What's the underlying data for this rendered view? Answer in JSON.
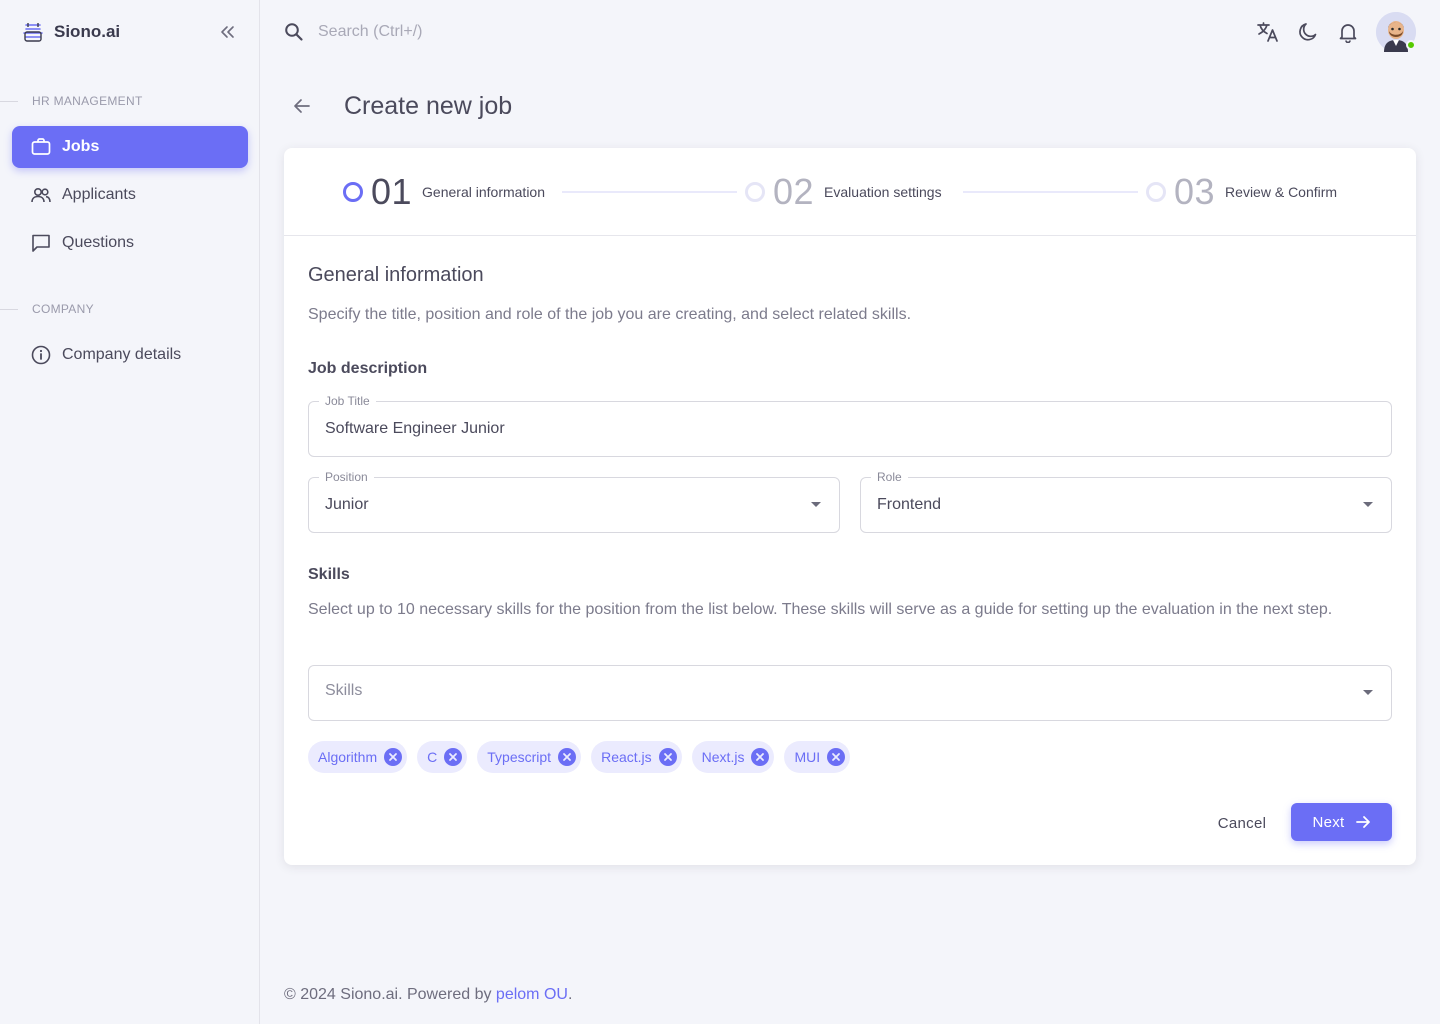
{
  "brand": {
    "name": "Siono.ai"
  },
  "sidebar": {
    "sections": [
      {
        "heading": "HR MANAGEMENT"
      },
      {
        "heading": "COMPANY"
      }
    ],
    "items": [
      {
        "label": "Jobs",
        "icon": "briefcase-icon",
        "active": true
      },
      {
        "label": "Applicants",
        "icon": "users-icon"
      },
      {
        "label": "Questions",
        "icon": "message-icon"
      },
      {
        "label": "Company details",
        "icon": "info-icon"
      }
    ]
  },
  "topbar": {
    "search_placeholder": "Search (Ctrl+/)",
    "icons": [
      "translate-icon",
      "moon-icon",
      "bell-icon"
    ],
    "status_color": "#56ca00"
  },
  "page": {
    "title": "Create new job"
  },
  "stepper": {
    "steps": [
      {
        "number": "01",
        "label": "General information",
        "active": true
      },
      {
        "number": "02",
        "label": "Evaluation settings"
      },
      {
        "number": "03",
        "label": "Review & Confirm"
      }
    ]
  },
  "general": {
    "title": "General information",
    "description": "Specify the title, position and role of the job you are creating, and select related skills.",
    "job_description_heading": "Job description"
  },
  "form": {
    "job_title": {
      "label": "Job Title",
      "value": "Software Engineer Junior"
    },
    "position": {
      "label": "Position",
      "value": "Junior"
    },
    "role": {
      "label": "Role",
      "value": "Frontend"
    }
  },
  "skills": {
    "heading": "Skills",
    "description": "Select up to 10 necessary skills for the position from the list below. These skills will serve as a guide for setting up the evaluation in the next step.",
    "placeholder": "Skills",
    "selected": [
      "Algorithm",
      "C",
      "Typescript",
      "React.js",
      "Next.js",
      "MUI"
    ]
  },
  "actions": {
    "cancel": "Cancel",
    "next": "Next"
  },
  "footer": {
    "text": "© 2024 Siono.ai. Powered by ",
    "link": "pelom OU",
    "suffix": "."
  },
  "colors": {
    "primary": "#6b6ef5",
    "chip_bg": "#ebebfe",
    "background": "#f4f5fa"
  }
}
